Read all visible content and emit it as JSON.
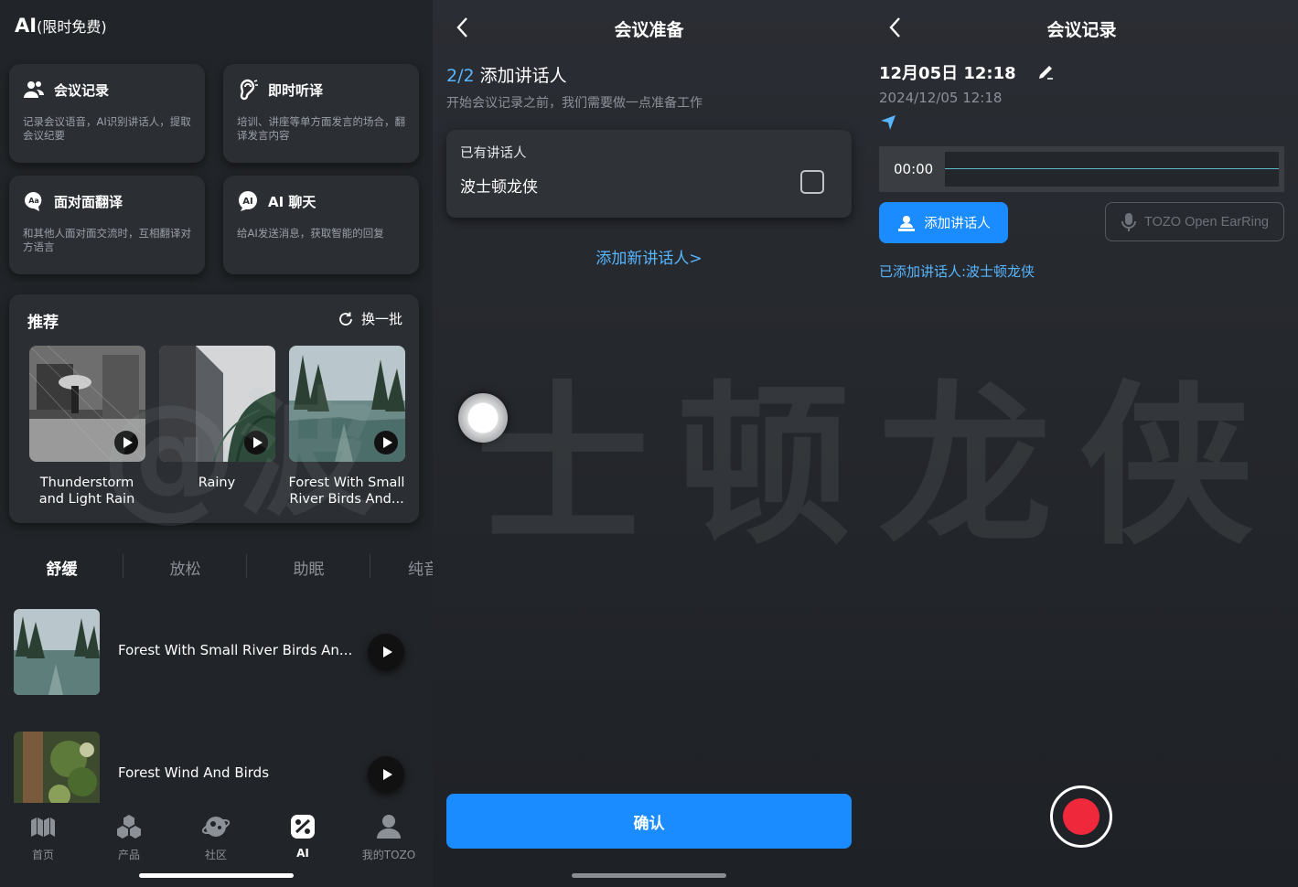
{
  "panel1": {
    "title": "AI",
    "title_suffix": "(限时免费)",
    "cards": [
      {
        "title": "会议记录",
        "desc": "记录会议语音，AI识别讲话人，提取会议纪要",
        "icon": "users-icon"
      },
      {
        "title": "即时听译",
        "desc": "培训、讲座等单方面发言的场合，翻译发言内容",
        "icon": "ear-icon"
      },
      {
        "title": "面对面翻译",
        "desc": "和其他人面对面交流时，互相翻译对方语言",
        "icon": "translate-icon"
      },
      {
        "title": "AI 聊天",
        "desc": "给AI发送消息，获取智能的回复",
        "icon": "ai-chat-icon"
      }
    ],
    "recommend": {
      "title": "推荐",
      "refresh": "换一批",
      "items": [
        {
          "line1": "Thunderstorm",
          "line2": "and Light Rain"
        },
        {
          "line1": "Rainy",
          "line2": ""
        },
        {
          "line1": "Forest With Small",
          "line2": "River Birds And..."
        }
      ]
    },
    "tabs": [
      "舒缓",
      "放松",
      "助眠",
      "纯音"
    ],
    "list": [
      {
        "name": "Forest With Small River Birds An..."
      },
      {
        "name": "Forest Wind And Birds"
      }
    ],
    "nav": [
      {
        "label": "首页",
        "icon": "home-icon"
      },
      {
        "label": "产品",
        "icon": "products-icon"
      },
      {
        "label": "社区",
        "icon": "community-icon"
      },
      {
        "label": "AI",
        "icon": "ai-icon"
      },
      {
        "label": "我的TOZO",
        "icon": "profile-icon"
      }
    ]
  },
  "panel2": {
    "title": "会议准备",
    "step": "2/2",
    "step_title": "添加讲话人",
    "subtitle": "开始会议记录之前，我们需要做一点准备工作",
    "existing_header": "已有讲话人",
    "speaker": "波士顿龙侠",
    "add_new": "添加新讲话人>",
    "confirm": "确认"
  },
  "panel3": {
    "title": "会议记录",
    "date": "12月05日 12:18",
    "timestamp": "2024/12/05 12:18",
    "timer": "00:00",
    "add_speaker": "添加讲话人",
    "device": "TOZO Open EarRing",
    "added": "已添加讲话人:波士顿龙侠"
  },
  "watermark": {
    "text1": "@波",
    "text2": "士顿龙侠"
  },
  "colors": {
    "accent": "#1a8cff",
    "link": "#58b6ff",
    "record": "#f0283c",
    "background": "#212428"
  }
}
